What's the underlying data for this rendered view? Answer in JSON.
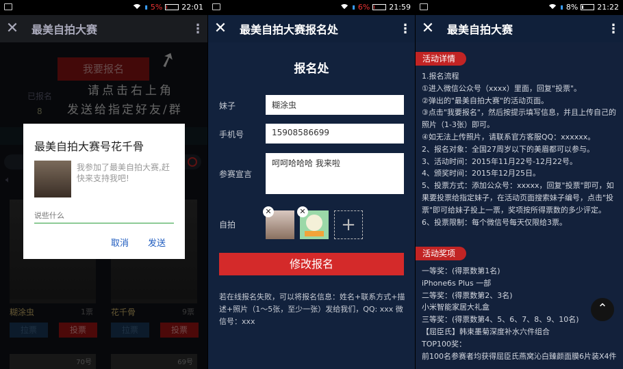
{
  "status_bars": [
    {
      "battery_pct": "5%",
      "time": "22:01",
      "battery_level": 0.05
    },
    {
      "battery_pct": "6%",
      "time": "21:59",
      "battery_level": 0.06
    },
    {
      "battery_pct": "8%",
      "time": "21:22",
      "battery_level": 0.08
    }
  ],
  "screen1": {
    "title": "最美自拍大赛",
    "join_button": "我要报名",
    "registered_label": "已报名",
    "registered_count": "8",
    "hand_text_1": "请点击右上角",
    "hand_text_2": "发送给指定好友/群",
    "cards": [
      {
        "name": "糊涂虫",
        "votes": "1票",
        "share": "拉票",
        "vote": "投票"
      },
      {
        "name": "花千骨",
        "votes": "9票",
        "share": "拉票",
        "vote": "投票"
      }
    ],
    "bottom_numbers": [
      "70号",
      "69号"
    ],
    "dialog": {
      "title": "最美自拍大赛号花千骨",
      "message": "我参加了最美自拍大赛,赶快来支持我吧!",
      "placeholder": "说些什么",
      "cancel": "取消",
      "send": "发送"
    }
  },
  "screen2": {
    "title": "最美自拍大赛报名处",
    "form_title": "报名处",
    "labels": {
      "name": "妹子",
      "phone": "手机号",
      "declaration": "参赛宣言",
      "selfie": "自拍"
    },
    "values": {
      "name": "糊涂虫",
      "phone": "15908586699",
      "declaration": "呵呵哈哈哈 我来啦"
    },
    "add_symbol": "+",
    "remove_symbol": "✕",
    "submit": "修改报名",
    "note": "若在线报名失败，可以将报名信息：姓名+联系方式+描述+照片（1～5张，至少一张）发给我们，QQ: xxx 微信号：xxx"
  },
  "screen3": {
    "title": "最美自拍大赛",
    "section1": "活动详情",
    "details": [
      "1.报名流程",
      "①进入微信公众号（xxxx）里面，回复\"投票\"。",
      "②弹出的\"最美自拍大赛\"的活动页面。",
      "③点击\"我要报名\"，然后按提示填写信息，并且上传自己的照片（1-3张）即可。",
      "④如无法上传照片，请联系官方客服QQ：xxxxxx。",
      "2、报名对象：全国27周岁以下的美眉都可以参与。",
      "3、活动时间：2015年11月22号-12月22号。",
      "4、颁奖时间：2015年12月25日。",
      "5、投票方式：添加公众号：xxxxx，回复\"投票\"即可，如果要投票给指定妹子，在活动页面搜索妹子编号，点击\"投票\"即可给妹子投上一票，奖项按所得票数的多少评定。",
      "6、投票限制：每个微信号每天仅限给3票。"
    ],
    "section2": "活动奖项",
    "prizes": [
      "一等奖：(得票数第1名)",
      "iPhone6s Plus 一部",
      "二等奖：(得票数第2、3名)",
      "小米智能家居大礼盒",
      "三等奖：(得票数第4、5、6、7、8、9、10名)",
      "【屈臣氏】韩束墨菊深度补水六件组合",
      "TOP100奖：",
      "前100名参赛者均获得屈臣氏燕窝沁白臻颜面膜6片装X4件"
    ]
  }
}
